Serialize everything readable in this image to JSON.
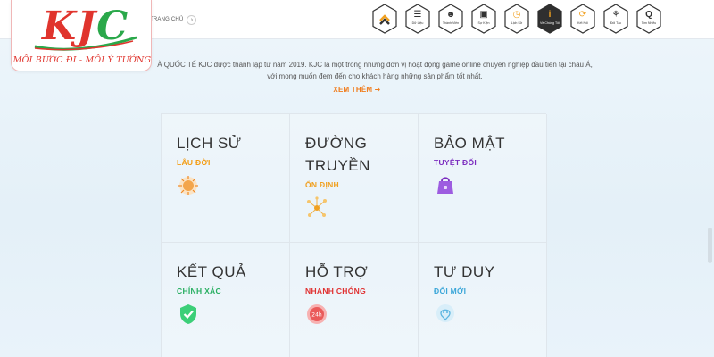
{
  "logo": {
    "k": "K",
    "j": "J",
    "c": "C",
    "slogan": "MỖI BƯỚC ĐI - MỖI Ý TƯỞNG"
  },
  "breadcrumb": {
    "home": "TRANG CHỦ",
    "chevron": "›"
  },
  "nav": [
    {
      "name": "home",
      "glyph": "︿",
      "label": ""
    },
    {
      "name": "data",
      "glyph": "☰",
      "label": "Dữ Liệu"
    },
    {
      "name": "members",
      "glyph": "☻",
      "label": "Thành Viên"
    },
    {
      "name": "events",
      "glyph": "▣",
      "label": "Sự Kiện"
    },
    {
      "name": "history",
      "glyph": "◷",
      "label": "Lịch Sử"
    },
    {
      "name": "about",
      "glyph": "i",
      "label": "Về Chúng Tôi"
    },
    {
      "name": "connect",
      "glyph": "⟳",
      "label": "Kết Nối"
    },
    {
      "name": "partners",
      "glyph": "⚘",
      "label": "Đối Tác"
    },
    {
      "name": "search",
      "glyph": "Q",
      "label": "Tìm Nhiễu"
    }
  ],
  "intro": {
    "line1": "À QUỐC TẾ KJC được thành lập từ năm 2019. KJC là một trong những đơn vị hoạt động game online chuyên nghiệp đầu tiên tại châu Á,",
    "line2": "với mong muốn đem đến cho khách hàng những sản phẩm tốt nhất.",
    "more": "XEM THÊM ➔"
  },
  "features": [
    {
      "title": "LỊCH SỬ",
      "sub": "LÂU ĐỜI",
      "color": "#f39c12",
      "icon": "sun-icon"
    },
    {
      "title": "ĐƯỜNG TRUYỀN",
      "sub": "ỔN ĐỊNH",
      "color": "#f0a020",
      "icon": "network-icon"
    },
    {
      "title": "BẢO MẬT",
      "sub": "TUYỆT ĐỐI",
      "color": "#7b2cbf",
      "icon": "shield-bag-icon"
    },
    {
      "title": "KẾT QUẢ",
      "sub": "CHÍNH XÁC",
      "color": "#27ae60",
      "icon": "check-shield-icon"
    },
    {
      "title": "HỖ TRỢ",
      "sub": "NHANH CHÓNG",
      "color": "#e03131",
      "icon": "support-icon"
    },
    {
      "title": "TƯ DUY",
      "sub": "ĐỔI MỚI",
      "color": "#3aa6d8",
      "icon": "brain-icon"
    }
  ]
}
